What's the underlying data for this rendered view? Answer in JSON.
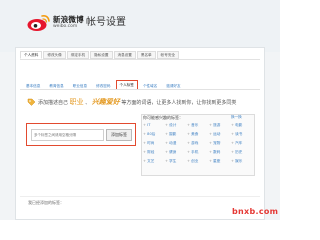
{
  "header": {
    "logo_text": "新浪微博",
    "logo_sub": "weibo.com",
    "page_title": "帐号设置"
  },
  "tabs_level1": [
    {
      "label": "个人资料",
      "active": true
    },
    {
      "label": "修改头像",
      "active": false
    },
    {
      "label": "绑定手机",
      "active": false
    },
    {
      "label": "隐私设置",
      "active": false
    },
    {
      "label": "消息设置",
      "active": false
    },
    {
      "label": "黑名单",
      "active": false
    },
    {
      "label": "帐号安全",
      "active": false
    }
  ],
  "tabs_level2": [
    {
      "label": "基本信息",
      "active": false
    },
    {
      "label": "教育信息",
      "active": false
    },
    {
      "label": "职业信息",
      "active": false
    },
    {
      "label": "修改密码",
      "active": false
    },
    {
      "label": "个人标签",
      "active": true
    },
    {
      "label": "个性域名",
      "active": false
    },
    {
      "label": "邀请好友",
      "active": false
    }
  ],
  "prompt": {
    "before": "添加描述自己",
    "word1": "职业",
    "mid": "、",
    "word2": "兴趣爱好",
    "after": "等方面的词语，让更多人找到你，让你找到更多同类"
  },
  "tag_input": {
    "placeholder": "多个标签之间请用空格分隔"
  },
  "add_button": {
    "label": "添加标签"
  },
  "suggestions": {
    "title": "你可能感兴趣的标签：",
    "refresh": "换一换",
    "items": [
      "IT",
      "设计",
      "音乐",
      "旅游",
      "电影",
      "80后",
      "摄影",
      "美食",
      "运动",
      "读书",
      "时尚",
      "动漫",
      "游戏",
      "宠物",
      "汽车",
      "财经",
      "健身",
      "手机",
      "数码",
      "历史",
      "文艺",
      "学生",
      "创业",
      "星座",
      "娱乐"
    ]
  },
  "footer": {
    "text": "我已经添加的标签："
  },
  "watermark": "bnxb.com",
  "colors": {
    "accent_orange": "#e49b25",
    "highlight_red": "#e24a2f",
    "link_blue": "#3a7ec2"
  }
}
